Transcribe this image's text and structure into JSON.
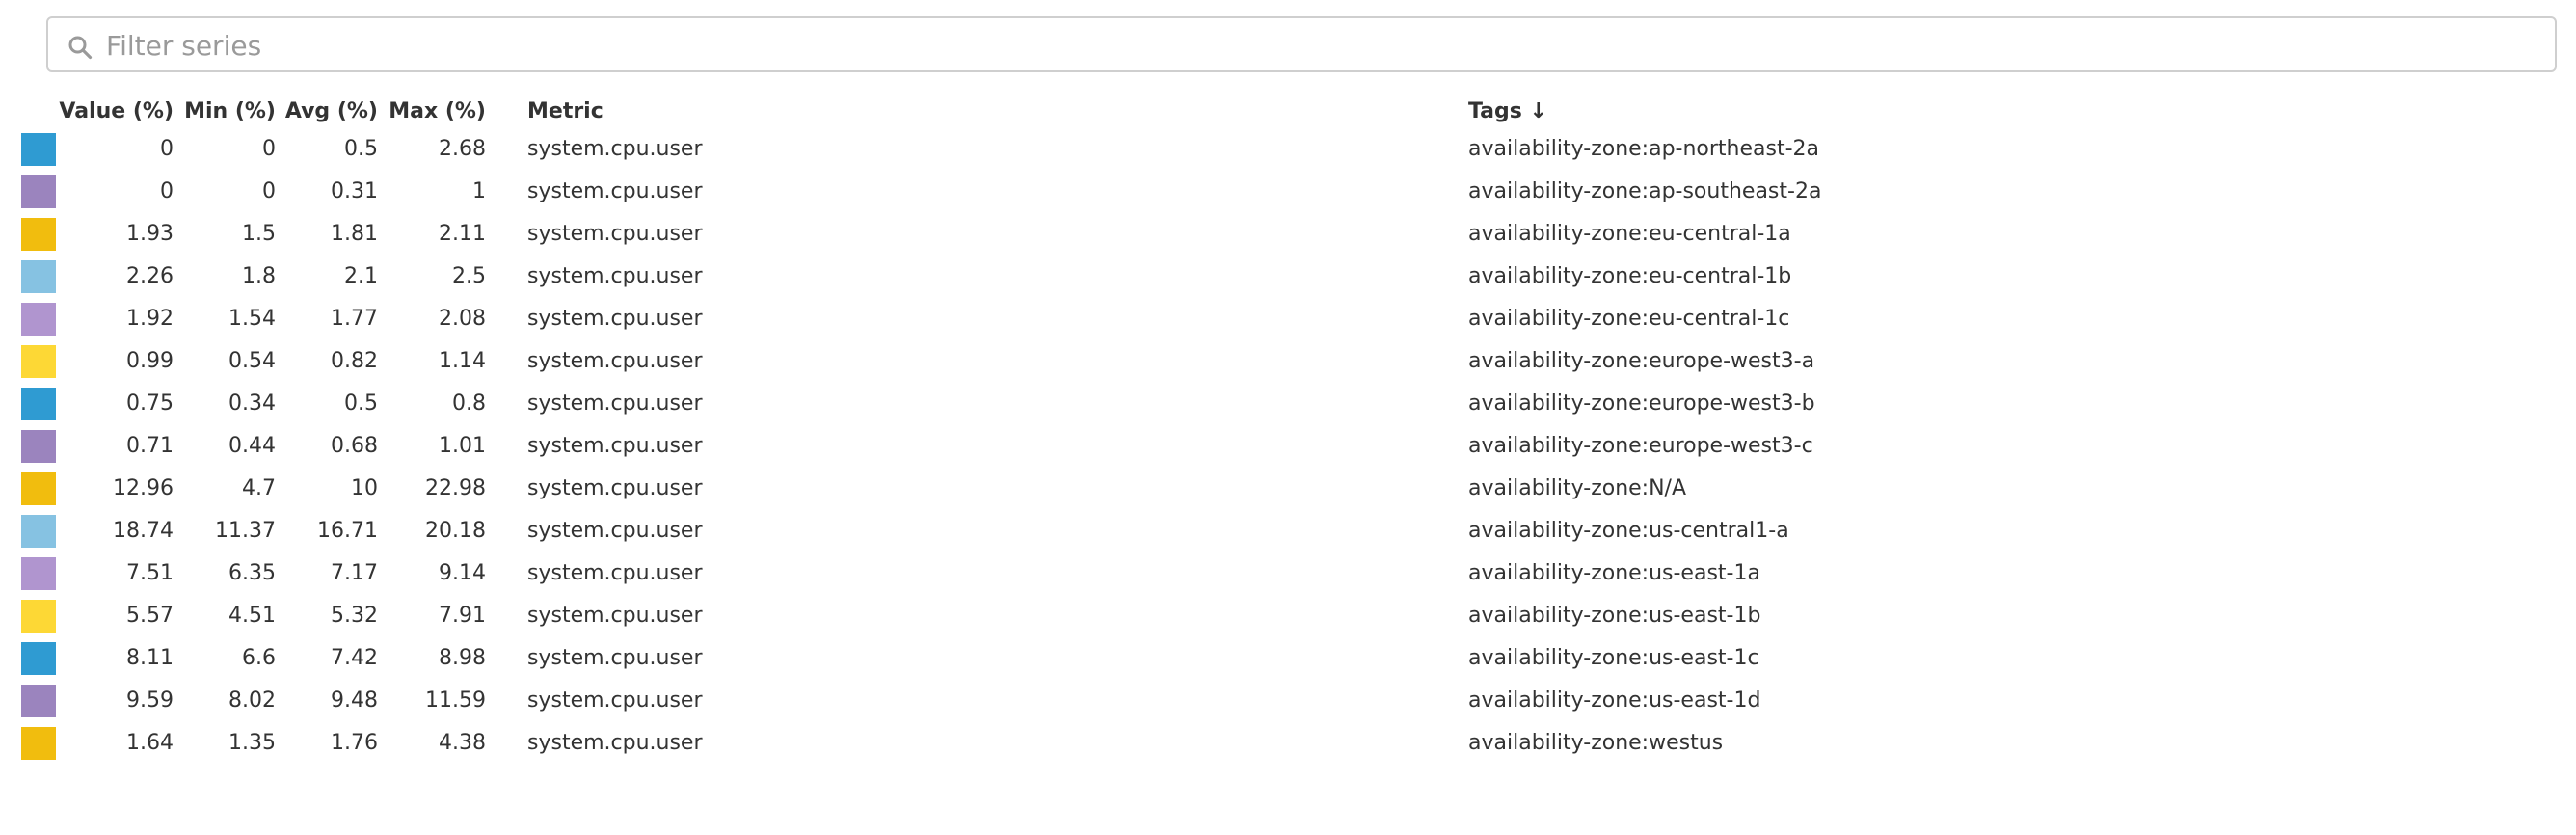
{
  "search": {
    "placeholder": "Filter series",
    "value": ""
  },
  "table": {
    "headers": {
      "value": "Value (%)",
      "min": "Min (%)",
      "avg": "Avg (%)",
      "max": "Max (%)",
      "metric": "Metric",
      "tags": "Tags ↓"
    },
    "rows": [
      {
        "color": "#2f9bd2",
        "value": "0",
        "min": "0",
        "avg": "0.5",
        "max": "2.68",
        "metric": "system.cpu.user",
        "tags": "availability-zone:ap-northeast-2a"
      },
      {
        "color": "#9b84be",
        "value": "0",
        "min": "0",
        "avg": "0.31",
        "max": "1",
        "metric": "system.cpu.user",
        "tags": "availability-zone:ap-southeast-2a"
      },
      {
        "color": "#f1bd0e",
        "value": "1.93",
        "min": "1.5",
        "avg": "1.81",
        "max": "2.11",
        "metric": "system.cpu.user",
        "tags": "availability-zone:eu-central-1a"
      },
      {
        "color": "#86c2e2",
        "value": "2.26",
        "min": "1.8",
        "avg": "2.1",
        "max": "2.5",
        "metric": "system.cpu.user",
        "tags": "availability-zone:eu-central-1b"
      },
      {
        "color": "#b095cf",
        "value": "1.92",
        "min": "1.54",
        "avg": "1.77",
        "max": "2.08",
        "metric": "system.cpu.user",
        "tags": "availability-zone:eu-central-1c"
      },
      {
        "color": "#fdd835",
        "value": "0.99",
        "min": "0.54",
        "avg": "0.82",
        "max": "1.14",
        "metric": "system.cpu.user",
        "tags": "availability-zone:europe-west3-a"
      },
      {
        "color": "#2f9bd2",
        "value": "0.75",
        "min": "0.34",
        "avg": "0.5",
        "max": "0.8",
        "metric": "system.cpu.user",
        "tags": "availability-zone:europe-west3-b"
      },
      {
        "color": "#9b84be",
        "value": "0.71",
        "min": "0.44",
        "avg": "0.68",
        "max": "1.01",
        "metric": "system.cpu.user",
        "tags": "availability-zone:europe-west3-c"
      },
      {
        "color": "#f1bd0e",
        "value": "12.96",
        "min": "4.7",
        "avg": "10",
        "max": "22.98",
        "metric": "system.cpu.user",
        "tags": "availability-zone:N/A"
      },
      {
        "color": "#86c2e2",
        "value": "18.74",
        "min": "11.37",
        "avg": "16.71",
        "max": "20.18",
        "metric": "system.cpu.user",
        "tags": "availability-zone:us-central1-a"
      },
      {
        "color": "#b095cf",
        "value": "7.51",
        "min": "6.35",
        "avg": "7.17",
        "max": "9.14",
        "metric": "system.cpu.user",
        "tags": "availability-zone:us-east-1a"
      },
      {
        "color": "#fdd835",
        "value": "5.57",
        "min": "4.51",
        "avg": "5.32",
        "max": "7.91",
        "metric": "system.cpu.user",
        "tags": "availability-zone:us-east-1b"
      },
      {
        "color": "#2f9bd2",
        "value": "8.11",
        "min": "6.6",
        "avg": "7.42",
        "max": "8.98",
        "metric": "system.cpu.user",
        "tags": "availability-zone:us-east-1c"
      },
      {
        "color": "#9b84be",
        "value": "9.59",
        "min": "8.02",
        "avg": "9.48",
        "max": "11.59",
        "metric": "system.cpu.user",
        "tags": "availability-zone:us-east-1d"
      },
      {
        "color": "#f1bd0e",
        "value": "1.64",
        "min": "1.35",
        "avg": "1.76",
        "max": "4.38",
        "metric": "system.cpu.user",
        "tags": "availability-zone:westus"
      }
    ]
  }
}
